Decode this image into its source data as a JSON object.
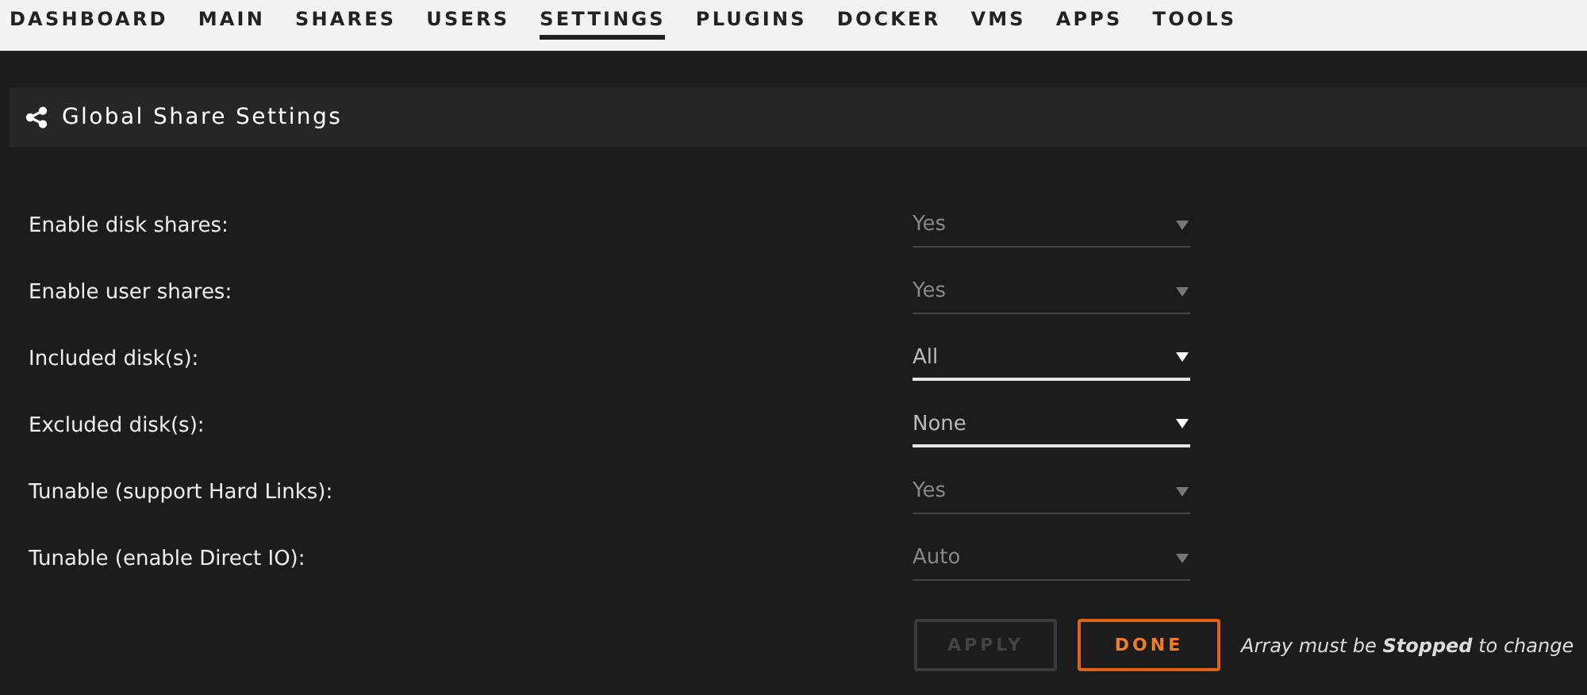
{
  "nav": [
    {
      "label": "DASHBOARD",
      "selected": false
    },
    {
      "label": "MAIN",
      "selected": false
    },
    {
      "label": "SHARES",
      "selected": false
    },
    {
      "label": "USERS",
      "selected": false
    },
    {
      "label": "SETTINGS",
      "selected": true
    },
    {
      "label": "PLUGINS",
      "selected": false
    },
    {
      "label": "DOCKER",
      "selected": false
    },
    {
      "label": "VMS",
      "selected": false
    },
    {
      "label": "APPS",
      "selected": false
    },
    {
      "label": "TOOLS",
      "selected": false
    }
  ],
  "section": {
    "title": "Global Share Settings"
  },
  "settings": [
    {
      "label": "Enable disk shares:",
      "value": "Yes",
      "disabled": true
    },
    {
      "label": "Enable user shares:",
      "value": "Yes",
      "disabled": true
    },
    {
      "label": "Included disk(s):",
      "value": "All",
      "disabled": false
    },
    {
      "label": "Excluded disk(s):",
      "value": "None",
      "disabled": false
    },
    {
      "label": "Tunable (support Hard Links):",
      "value": "Yes",
      "disabled": true
    },
    {
      "label": "Tunable (enable Direct IO):",
      "value": "Auto",
      "disabled": true
    }
  ],
  "buttons": [
    {
      "label": "APPLY",
      "disabled": true
    },
    {
      "label": "DONE",
      "disabled": false
    }
  ],
  "note": "Array must be **Stopped** to change"
}
